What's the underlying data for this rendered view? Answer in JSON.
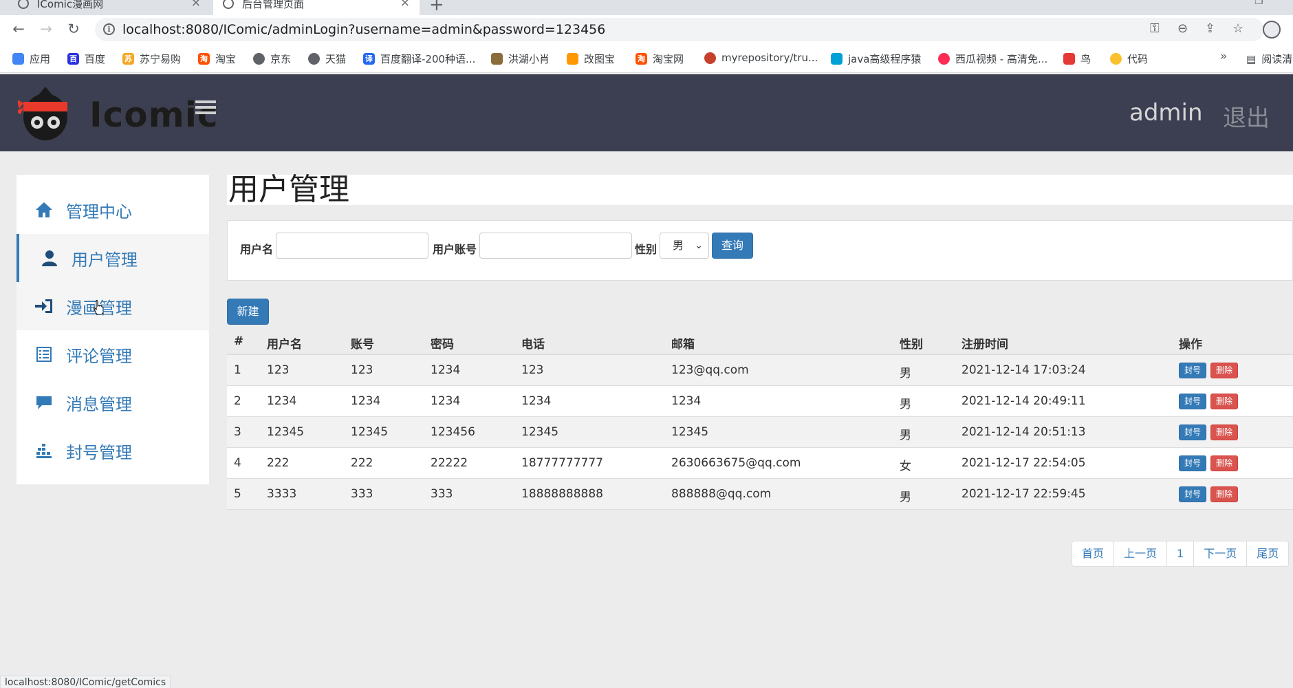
{
  "browser": {
    "tabs": [
      {
        "title": "IComic漫画网"
      },
      {
        "title": "后台管理页面"
      }
    ],
    "url": "localhost:8080/IComic/adminLogin?username=admin&password=123456",
    "bookmarks": [
      {
        "label": "应用",
        "color": "#4285f4"
      },
      {
        "label": "百度",
        "color": "#2932e1"
      },
      {
        "label": "苏宁易购",
        "color": "#f5a623"
      },
      {
        "label": "淘宝",
        "color": "#ff5000"
      },
      {
        "label": "京东",
        "color": "#5f6368"
      },
      {
        "label": "天猫",
        "color": "#5f6368"
      },
      {
        "label": "百度翻译-200种语...",
        "color": "#2468f2"
      },
      {
        "label": "洪湖小肖",
        "color": "#8a6d3b"
      },
      {
        "label": "改图宝",
        "color": "#ff9800"
      },
      {
        "label": "淘宝网",
        "color": "#ff5000"
      },
      {
        "label": "myrepository/tru...",
        "color": "#c7402d"
      },
      {
        "label": "java高级程序猿",
        "color": "#00a1d6"
      },
      {
        "label": "西瓜视频 - 高清免...",
        "color": "#fe2c55"
      },
      {
        "label": "鸟",
        "color": "#e53935"
      },
      {
        "label": "代码",
        "color": "#fbc02d"
      }
    ],
    "reading_list": "阅读清",
    "status_url": "localhost:8080/IComic/getComics"
  },
  "header": {
    "logo_text": "Icomic",
    "user": "admin",
    "logout": "退出"
  },
  "sidebar": {
    "items": [
      {
        "label": "管理中心",
        "icon": "home-icon"
      },
      {
        "label": "用户管理",
        "icon": "user-icon"
      },
      {
        "label": "漫画管理",
        "icon": "login-icon"
      },
      {
        "label": "评论管理",
        "icon": "list-icon"
      },
      {
        "label": "消息管理",
        "icon": "comment-icon"
      },
      {
        "label": "封号管理",
        "icon": "tasks-icon"
      }
    ]
  },
  "main": {
    "title": "用户管理",
    "search": {
      "username_label": "用户名",
      "username_value": "",
      "account_label": "用户账号",
      "account_value": "",
      "gender_label": "性别",
      "gender_value": "男",
      "query_button": "查询"
    },
    "new_button": "新建",
    "table": {
      "columns": [
        "#",
        "用户名",
        "账号",
        "密码",
        "电话",
        "邮箱",
        "性别",
        "注册时间",
        "操作"
      ],
      "rows": [
        {
          "id": "1",
          "username": "123",
          "account": "123",
          "password": "1234",
          "phone": "123",
          "email": "123@qq.com",
          "gender": "男",
          "registered": "2021-12-14 17:03:24"
        },
        {
          "id": "2",
          "username": "1234",
          "account": "1234",
          "password": "1234",
          "phone": "1234",
          "email": "1234",
          "gender": "男",
          "registered": "2021-12-14 20:49:11"
        },
        {
          "id": "3",
          "username": "12345",
          "account": "12345",
          "password": "123456",
          "phone": "12345",
          "email": "12345",
          "gender": "男",
          "registered": "2021-12-14 20:51:13"
        },
        {
          "id": "4",
          "username": "222",
          "account": "222",
          "password": "22222",
          "phone": "18777777777",
          "email": "2630663675@qq.com",
          "gender": "女",
          "registered": "2021-12-17 22:54:05"
        },
        {
          "id": "5",
          "username": "3333",
          "account": "333",
          "password": "333",
          "phone": "18888888888",
          "email": "888888@qq.com",
          "gender": "男",
          "registered": "2021-12-17 22:59:45"
        }
      ],
      "ban_label": "封号",
      "delete_label": "删除"
    },
    "pagination": {
      "first": "首页",
      "prev": "上一页",
      "current": "1",
      "next": "下一页",
      "last": "尾页"
    }
  },
  "colors": {
    "header_bg": "#3c3f51",
    "primary": "#337ab7",
    "danger": "#d9534f"
  }
}
